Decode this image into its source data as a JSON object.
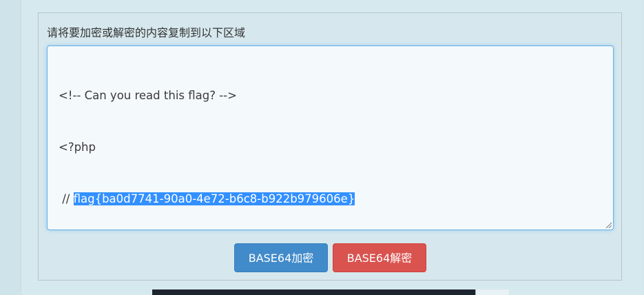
{
  "form": {
    "label": "请将要加密或解密的内容复制到以下区域",
    "lines": [
      "<!-- Can you read this flag? -->",
      "<?php",
      " // ",
      "?>"
    ],
    "selected_text": "flag{ba0d7741-90a0-4e72-b6c8-b922b979606e}"
  },
  "buttons": {
    "encode_label": "BASE64加密",
    "decode_label": "BASE64解密"
  },
  "colors": {
    "background": "#d3e7ec",
    "primary_button": "#428bca",
    "danger_button": "#d9534f",
    "selection": "#3390ff",
    "focus_border": "#66afe9"
  }
}
